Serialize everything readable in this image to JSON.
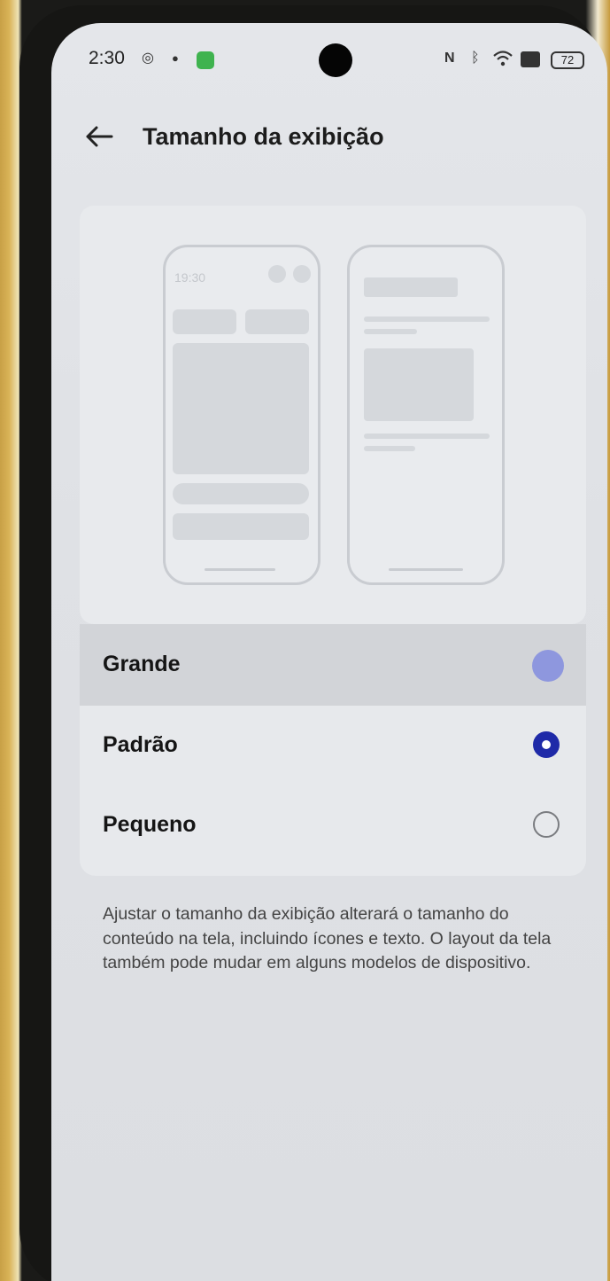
{
  "status_bar": {
    "time": "2:30",
    "icons": [
      "alarm-icon",
      "bug-icon",
      "app-badge-icon",
      "nfc-icon",
      "bluetooth-icon",
      "wifi-icon",
      "sim-icon"
    ],
    "battery": "72"
  },
  "header": {
    "title": "Tamanho da exibição"
  },
  "preview": {
    "mock_time": "19:30"
  },
  "options": [
    {
      "label": "Grande",
      "selected": false,
      "pressed": true
    },
    {
      "label": "Padrão",
      "selected": true
    },
    {
      "label": "Pequeno",
      "selected": false
    }
  ],
  "description": "Ajustar o tamanho da exibição alterará o tamanho do conteúdo na tela, incluindo ícones e texto. O layout da tela também pode mudar em alguns modelos de dispositivo.",
  "colors": {
    "accent": "#1f2aa8",
    "accent_pressed": "#8e97de"
  }
}
